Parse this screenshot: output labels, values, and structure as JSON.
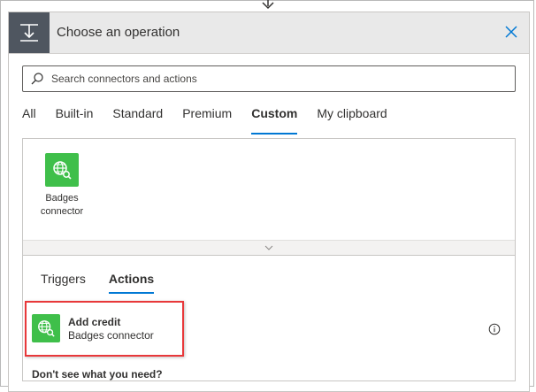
{
  "header": {
    "title": "Choose an operation"
  },
  "search": {
    "placeholder": "Search connectors and actions",
    "value": ""
  },
  "tabs": [
    {
      "label": "All"
    },
    {
      "label": "Built-in"
    },
    {
      "label": "Standard"
    },
    {
      "label": "Premium"
    },
    {
      "label": "Custom",
      "active": true
    },
    {
      "label": "My clipboard"
    }
  ],
  "connectors": [
    {
      "label_line1": "Badges",
      "label_line2": "connector",
      "icon": "globe-search-icon",
      "color": "#3fbf4a"
    }
  ],
  "subtabs": [
    {
      "label": "Triggers"
    },
    {
      "label": "Actions",
      "active": true
    }
  ],
  "actions": [
    {
      "title": "Add credit",
      "subtitle": "Badges connector",
      "icon": "globe-search-icon",
      "color": "#3fbf4a"
    }
  ],
  "footer": {
    "dont_see": "Don't see what you need?"
  },
  "colors": {
    "accent": "#0078d4",
    "highlight": "#e8383a",
    "header_bg": "#e9e9e9",
    "header_icon_bg": "#4f5660"
  }
}
